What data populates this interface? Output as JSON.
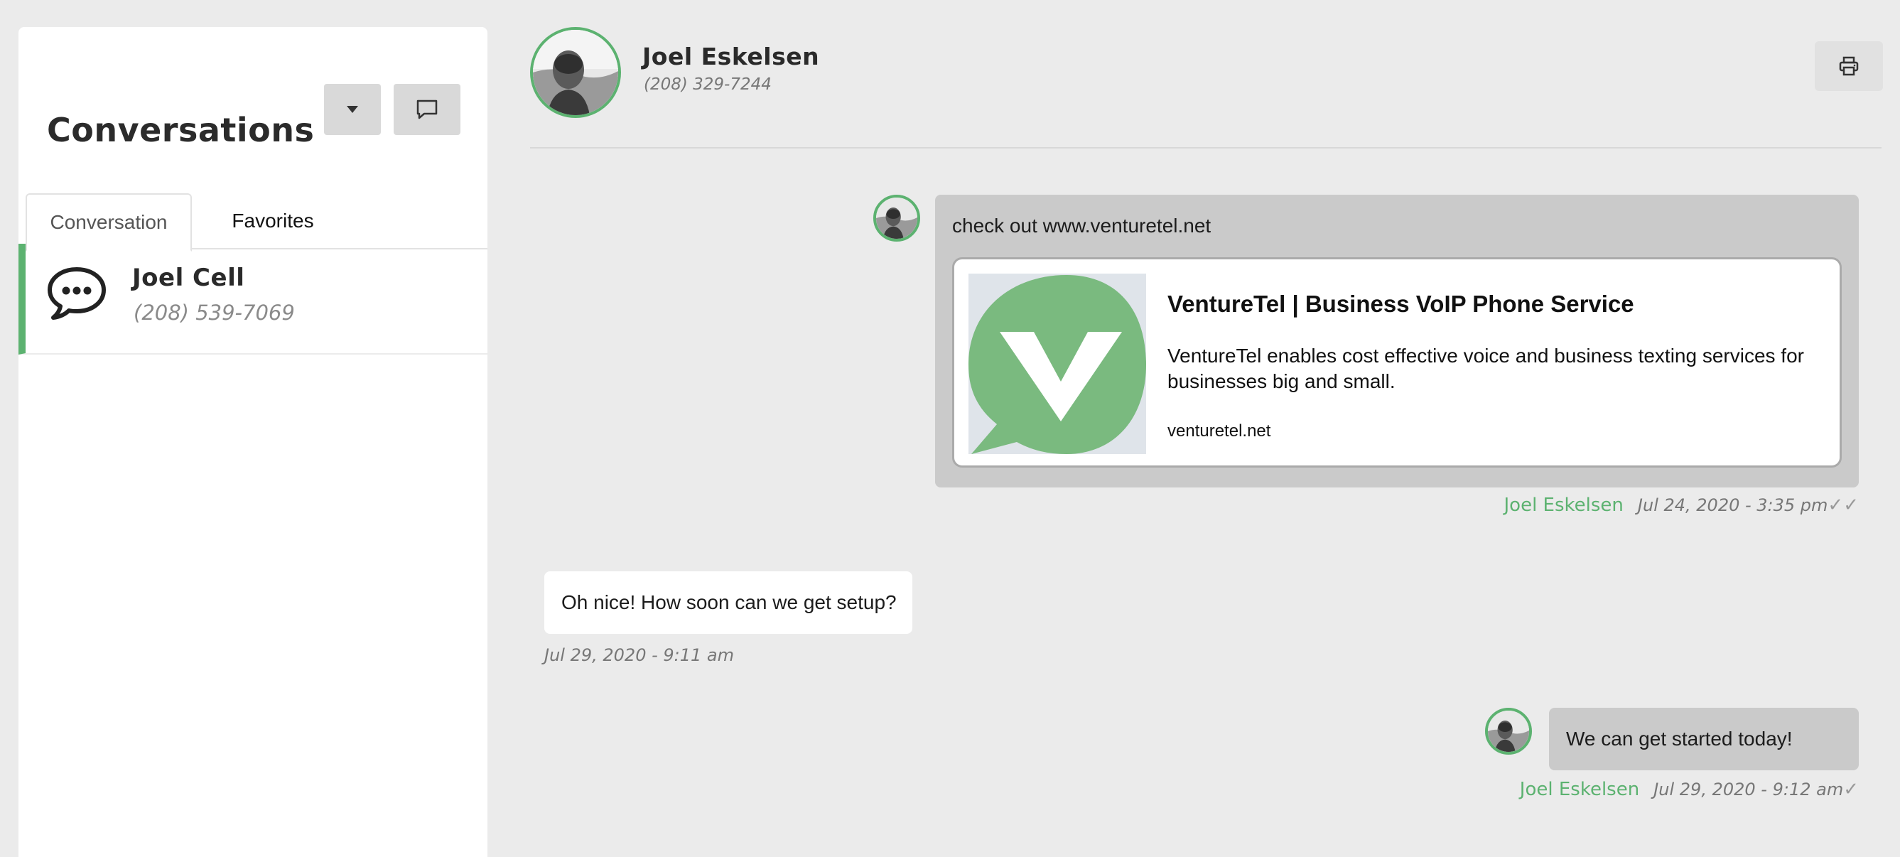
{
  "sidebar": {
    "title": "Conversations",
    "dropdown_icon": "caret-down-icon",
    "new_message_icon": "message-icon",
    "tabs": [
      {
        "label": "Conversation",
        "active": true
      },
      {
        "label": "Favorites",
        "active": false
      }
    ],
    "conversations": [
      {
        "name": "Joel Cell",
        "phone": "(208) 539-7069",
        "icon": "chat-bubble-icon",
        "selected": true
      }
    ]
  },
  "header": {
    "contact_name": "Joel Eskelsen",
    "contact_phone": "(208) 329-7244",
    "print_icon": "print-icon"
  },
  "messages": [
    {
      "direction": "outgoing",
      "text": "check out www.venturetel.net",
      "link_preview": {
        "title": "VentureTel | Business VoIP Phone Service",
        "description": "VentureTel enables cost effective voice and business texting services for businesses big and small.",
        "domain": "venturetel.net"
      },
      "sender": "Joel Eskelsen",
      "timestamp": "Jul 24, 2020 - 3:35 pm",
      "status": "✓✓"
    },
    {
      "direction": "incoming",
      "text": "Oh nice! How soon can we get setup?",
      "timestamp": "Jul 29, 2020 - 9:11 am"
    },
    {
      "direction": "outgoing",
      "text": "We can get started today!",
      "sender": "Joel Eskelsen",
      "timestamp": "Jul 29, 2020 - 9:12 am",
      "status": "✓"
    }
  ],
  "colors": {
    "accent": "#5cb270",
    "outgoing_bubble": "#cacaca",
    "incoming_bubble": "#ffffff",
    "background": "#ebebeb"
  }
}
